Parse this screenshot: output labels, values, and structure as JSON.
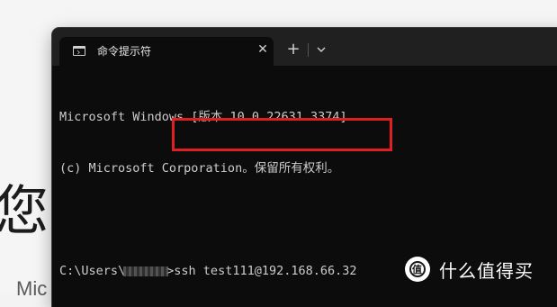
{
  "background": {
    "heading_fragment": "您的",
    "subtext_fragment": "Mic"
  },
  "terminal": {
    "tab_title": "命令提示符",
    "tab_close": "✕",
    "new_tab": "+",
    "lines": {
      "version": "Microsoft Windows [版本 10.0.22631.3374]",
      "copyright": "(c) Microsoft Corporation。保留所有权利。",
      "prompt_prefix": "C:\\Users\\",
      "prompt_suffix": ">",
      "command": "ssh test111@192.168.66.32"
    }
  },
  "watermark": {
    "text": "什么值得买"
  },
  "colors": {
    "terminal_bg": "#0c0c0c",
    "titlebar_bg": "#202020",
    "text": "#cccccc",
    "highlight": "#e02020"
  }
}
